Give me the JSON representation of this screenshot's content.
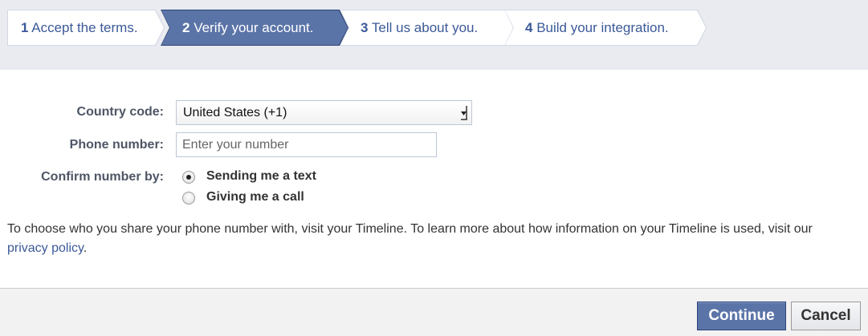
{
  "steps": [
    {
      "num": "1",
      "label": "Accept the terms.",
      "active": false
    },
    {
      "num": "2",
      "label": "Verify your account.",
      "active": true
    },
    {
      "num": "3",
      "label": "Tell us about you.",
      "active": false
    },
    {
      "num": "4",
      "label": "Build your integration.",
      "active": false
    }
  ],
  "form": {
    "country_label": "Country code:",
    "country_value": "United States (+1)",
    "phone_label": "Phone number:",
    "phone_placeholder": "Enter your number",
    "phone_value": "",
    "confirm_label": "Confirm number by:",
    "options": [
      {
        "label": "Sending me a text",
        "selected": true
      },
      {
        "label": "Giving me a call",
        "selected": false
      }
    ]
  },
  "info": {
    "text": "To choose who you share your phone number with, visit your Timeline. To learn more about how information on your Timeline is used, visit our ",
    "link": "privacy policy",
    "end": "."
  },
  "footer": {
    "continue_label": "Continue",
    "cancel_label": "Cancel"
  },
  "colors": {
    "brand": "#3b5998",
    "active_step": "#5b74a8",
    "top_band": "#e9ebf1"
  }
}
